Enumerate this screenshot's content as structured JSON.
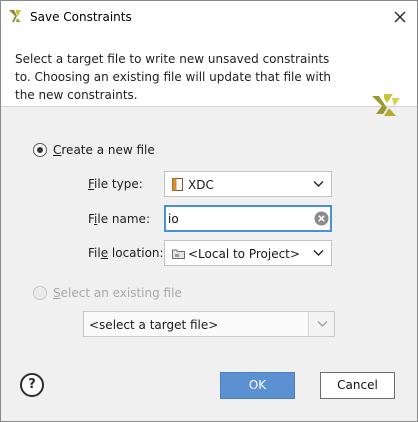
{
  "window": {
    "title": "Save Constraints"
  },
  "header": {
    "description": "Select a target file to write new unsaved constraints to. Choosing an existing file will update that file with the new constraints."
  },
  "options": {
    "create_new": {
      "label_mnemonic": "C",
      "label_rest": "reate a new file",
      "selected": true
    },
    "select_existing": {
      "label_mnemonic": "S",
      "label_rest": "elect an existing file",
      "selected": false,
      "enabled": false
    }
  },
  "form": {
    "file_type": {
      "label_mnemonic": "F",
      "label_rest": "ile type:",
      "value": "XDC"
    },
    "file_name": {
      "label_pre": "F",
      "label_mnemonic": "i",
      "label_rest": "le name:",
      "value": "io"
    },
    "file_location": {
      "label_pre": "Fil",
      "label_mnemonic": "e",
      "label_rest": " location:",
      "value": "<Local to Project>"
    },
    "target_file": {
      "value": "<select a target file>"
    }
  },
  "buttons": {
    "help": "?",
    "ok": "OK",
    "cancel": "Cancel"
  },
  "colors": {
    "accent": "#5b91d2",
    "focus_border": "#4a90d9",
    "logo_yellow": "#c9c23a"
  },
  "icons": {
    "app": "vivado-logo-icon",
    "close": "close-icon",
    "file_type": "xdc-file-icon",
    "folder": "folder-icon",
    "clear": "clear-circle-icon",
    "dropdown": "chevron-down-icon"
  }
}
